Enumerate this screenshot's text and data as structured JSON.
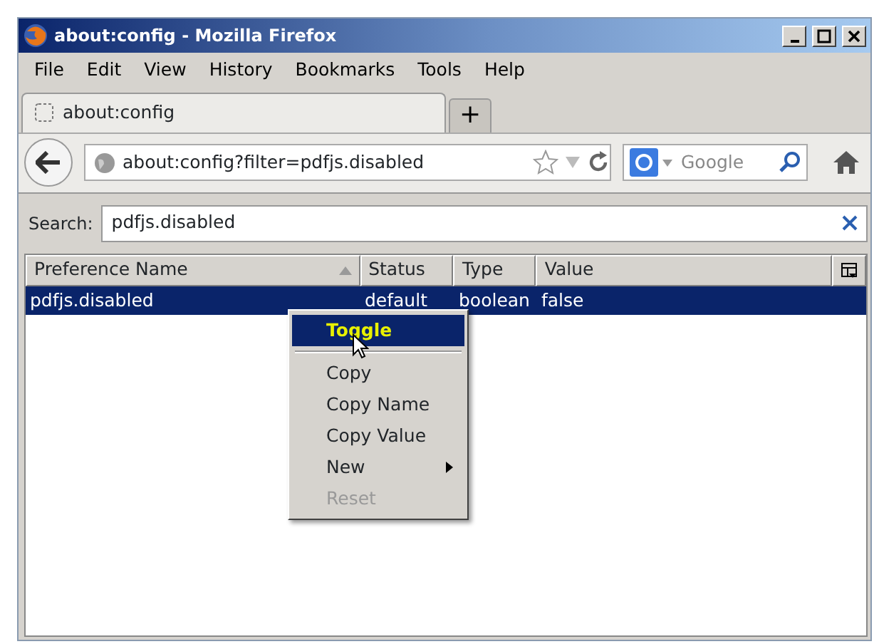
{
  "window": {
    "title": "about:config - Mozilla Firefox"
  },
  "menu_bar": [
    "File",
    "Edit",
    "View",
    "History",
    "Bookmarks",
    "Tools",
    "Help"
  ],
  "tabs": [
    {
      "label": "about:config",
      "selected": true
    }
  ],
  "new_tab": "+",
  "address_bar": {
    "value": "about:config?filter=pdfjs.disabled"
  },
  "search_box": {
    "placeholder": "Google"
  },
  "filter": {
    "label": "Search:",
    "value": "pdfjs.disabled"
  },
  "table": {
    "columns": [
      "Preference Name",
      "Status",
      "Type",
      "Value"
    ],
    "rows": [
      {
        "cells": [
          "pdfjs.disabled",
          "default",
          "boolean",
          "false"
        ],
        "selected": true
      }
    ]
  },
  "context_menu": [
    {
      "label": "Toggle",
      "kind": "item",
      "selected": true,
      "disabled": false
    },
    {
      "kind": "separator"
    },
    {
      "label": "Copy",
      "kind": "item",
      "selected": false,
      "disabled": false
    },
    {
      "label": "Copy Name",
      "kind": "item",
      "selected": false,
      "disabled": false
    },
    {
      "label": "Copy Value",
      "kind": "item",
      "selected": false,
      "disabled": false
    },
    {
      "label": "New",
      "kind": "submenu",
      "selected": false,
      "disabled": false
    },
    {
      "label": "Reset",
      "kind": "item",
      "selected": false,
      "disabled": true
    }
  ]
}
